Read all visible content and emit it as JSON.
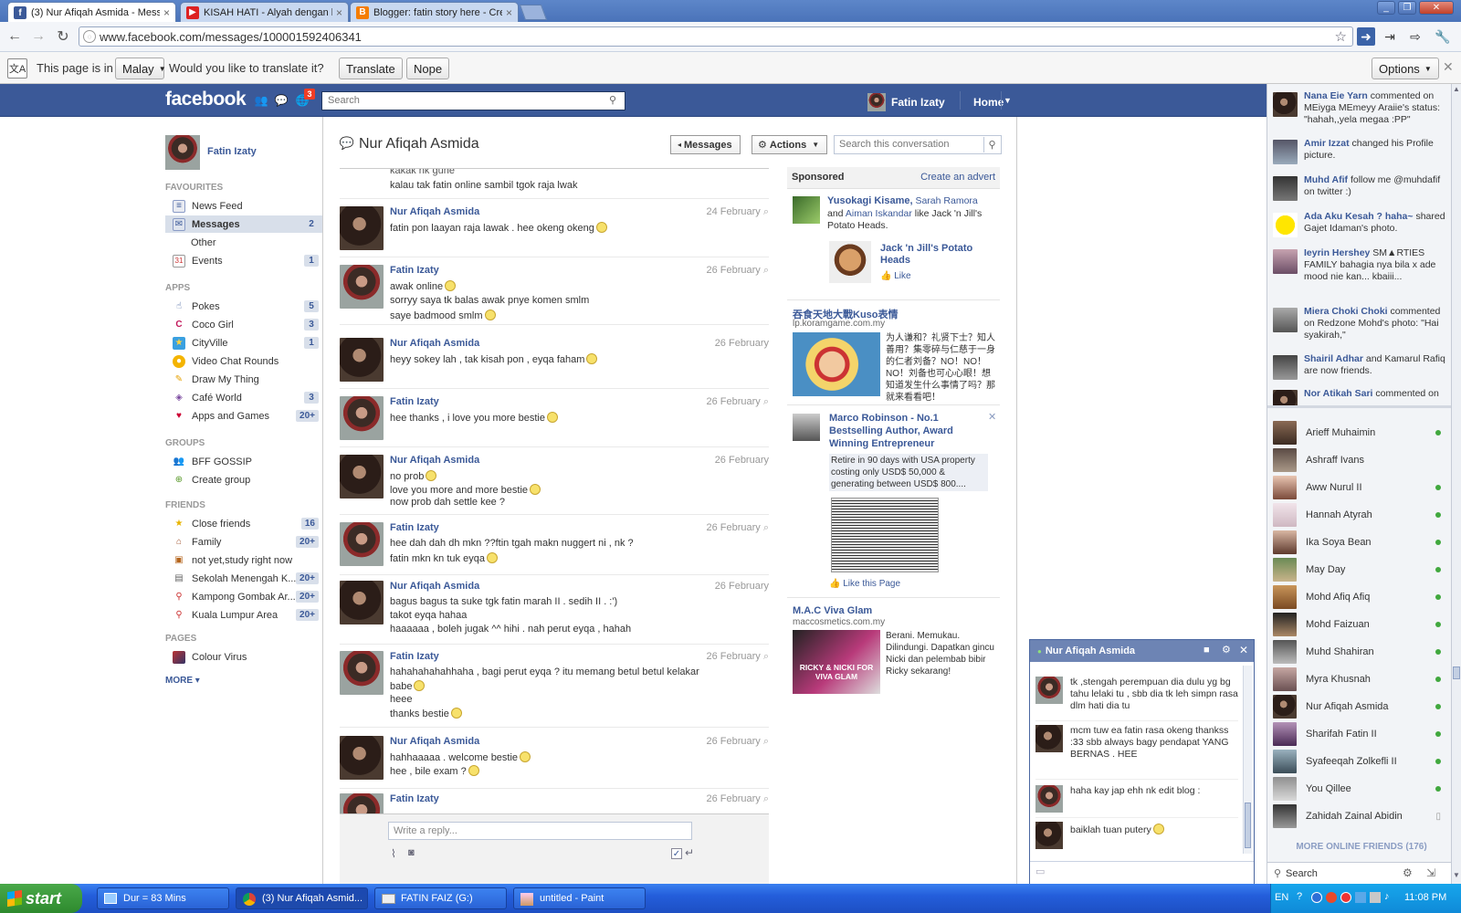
{
  "browser": {
    "tabs": [
      {
        "title": "(3) Nur Afiqah Asmida - Messa"
      },
      {
        "title": "KISAH HATI - Alyah dengan lir"
      },
      {
        "title": "Blogger: fatin story here - Cre"
      }
    ],
    "url": "www.facebook.com/messages/100001592406341"
  },
  "translate_bar": {
    "prefix": "This page is in",
    "language": "Malay",
    "question": "Would you like to translate it?",
    "translate_label": "Translate",
    "nope_label": "Nope",
    "options_label": "Options"
  },
  "fb": {
    "logo": "facebook",
    "notif_count": "3",
    "search_placeholder": "Search",
    "user_name": "Fatin Izaty",
    "home_label": "Home"
  },
  "leftnav": {
    "profile_name": "Fatin Izaty",
    "sections": {
      "favourites": "FAVOURITES",
      "apps": "APPS",
      "groups": "GROUPS",
      "friends": "FRIENDS",
      "pages": "PAGES"
    },
    "favourites": [
      {
        "label": "News Feed",
        "count": ""
      },
      {
        "label": "Messages",
        "count": "2"
      },
      {
        "label": "Other",
        "count": ""
      },
      {
        "label": "Events",
        "count": "1"
      }
    ],
    "apps": [
      {
        "label": "Pokes",
        "count": "5"
      },
      {
        "label": "Coco Girl",
        "count": "3"
      },
      {
        "label": "CityVille",
        "count": "1"
      },
      {
        "label": "Video Chat Rounds",
        "count": ""
      },
      {
        "label": "Draw My Thing",
        "count": ""
      },
      {
        "label": "Café World",
        "count": "3"
      },
      {
        "label": "Apps and Games",
        "count": "20+"
      }
    ],
    "groups": [
      {
        "label": "BFF GOSSIP"
      },
      {
        "label": "Create group"
      }
    ],
    "friends": [
      {
        "label": "Close friends",
        "count": "16"
      },
      {
        "label": "Family",
        "count": "20+"
      },
      {
        "label": "not yet,study right now",
        "count": ""
      },
      {
        "label": "Sekolah Menengah K...",
        "count": "20+"
      },
      {
        "label": "Kampong Gombak Ar...",
        "count": "20+"
      },
      {
        "label": "Kuala Lumpur Area",
        "count": "20+"
      }
    ],
    "pages": [
      {
        "label": "Colour Virus"
      }
    ],
    "more_label": "MORE"
  },
  "conversation": {
    "title": "Nur Afiqah Asmida",
    "messages_btn": "Messages",
    "actions_btn": "Actions",
    "search_placeholder": "Search this conversation",
    "top_partial": [
      "kakak nk gune",
      "kalau tak fatin online sambil tgok raja lwak"
    ],
    "messages": [
      {
        "name": "Nur Afiqah Asmida",
        "date": "24 February",
        "lines": [
          "fatin pon laayan raja lawak . hee okeng okeng"
        ]
      },
      {
        "name": "Fatin Izaty",
        "date": "26 February",
        "lines": [
          "awak online",
          "sorryy saya tk balas awak pnye komen smlm",
          "saye badmood smlm"
        ]
      },
      {
        "name": "Nur Afiqah Asmida",
        "date": "26 February",
        "lines": [
          "heyy  sokey lah , tak kisah pon , eyqa faham"
        ]
      },
      {
        "name": "Fatin Izaty",
        "date": "26 February",
        "lines": [
          "hee  thanks ,  i love you more bestie"
        ]
      },
      {
        "name": "Nur Afiqah Asmida",
        "date": "26 February",
        "lines": [
          "no prob",
          "love you more and more bestie",
          "now prob dah settle kee ?"
        ]
      },
      {
        "name": "Fatin Izaty",
        "date": "26 February",
        "lines": [
          "hee dah dah  dh mkn ??ftin tgah makn nuggert ni , nk ?",
          "fatin mkn kn tuk eyqa"
        ]
      },
      {
        "name": "Nur Afiqah Asmida",
        "date": "26 February",
        "lines": [
          "bagus bagus  ta suke tgk fatin marah II . sedih II . :')",
          "takot eyqa  hahaa",
          "haaaaaa , boleh jugak ^^ hihi . nah perut eyqa , hahah"
        ]
      },
      {
        "name": "Fatin Izaty",
        "date": "26 February",
        "lines": [
          "hahahahahahhaha , bagi perut eyqa ? itu memang betul betul kelakar",
          "babe",
          "heee",
          "thanks bestie"
        ]
      },
      {
        "name": "Nur Afiqah Asmida",
        "date": "26 February",
        "lines": [
          "hahhaaaaa . welcome bestie",
          "hee , bile exam ?"
        ]
      },
      {
        "name": "Fatin Izaty",
        "date": "26 February",
        "lines": []
      }
    ],
    "reply_placeholder": "Write a reply..."
  },
  "sponsored": {
    "heading": "Sponsored",
    "create_advert": "Create an advert",
    "social_ad": {
      "names": "Yusokagi Kisame,",
      "name2": "Sarah Ramora",
      "and_text": "and",
      "name3": "Aiman Iskandar",
      "like_text": "like Jack 'n Jill's Potato Heads.",
      "page": "Jack 'n Jill's Potato Heads",
      "like_label": "Like"
    },
    "ad1": {
      "title": "吞食天地大戰Kuso表情",
      "domain": "lp.koramgame.com.my",
      "body": "为人谦和？礼贤下士？知人善用？集零碎与仁慈于一身的仁者刘备？NO！NO！NO！刘备也可心心眼！想知道发生什么事情了吗？那就来看看吧！"
    },
    "ad2": {
      "title": "Marco Robinson - No.1 Bestselling Author, Award Winning Entrepreneur",
      "body": "Retire in 90 days with USA property costing only USD$ 50,000 & generating between USD$ 800....",
      "like_page": "Like this Page"
    },
    "ad3": {
      "title": "M.A.C Viva Glam",
      "domain": "maccosmetics.com.my",
      "body": "Berani. Memukau. Dilindungi. Dapatkan gincu Nicki dan pelembab bibir Ricky sekarang!",
      "image_text": "RICKY & NICKI FOR VIVA GLAM"
    }
  },
  "ticker": [
    {
      "name": "Nana Eie Yarn",
      "text": "commented on MEiyga MEmeyy Araiie's status: \"hahah,,yela megaa :PP\""
    },
    {
      "name": "Amir Izzat",
      "text": "changed his Profile picture."
    },
    {
      "name": "Muhd Afif",
      "text": "follow me @muhdafif on twitter :)"
    },
    {
      "name": "Ada Aku Kesah ? haha~",
      "text": "shared Gajet Idaman's photo."
    },
    {
      "name": "Ieyrin Hershey",
      "text": "SM▲RTIES FAMILY bahagia nya bila x ade mood nie kan... kbaiii..."
    },
    {
      "name": "Miera Choki Choki",
      "text": "commented on Redzone Mohd's photo: \"Hai syakirah,\""
    },
    {
      "name": "Shairil Adhar",
      "text": "and Kamarul Rafiq are now friends."
    },
    {
      "name": "Nor Atikah Sari",
      "text": "commented on"
    }
  ],
  "online_friends": [
    "Arieff Muhaimin",
    "Ashraff Ivans",
    "Aww Nurul II",
    "Hannah Atyrah",
    "Ika Soya Bean",
    "May Day",
    "Mohd Afiq Afiq",
    "Mohd Faizuan",
    "Muhd Shahiran",
    "Myra Khusnah",
    "Nur Afiqah Asmida",
    "Sharifah Fatin II",
    "Syafeeqah Zolkefli II",
    "You Qillee",
    "Zahidah Zainal Abidin"
  ],
  "more_online": "MORE ONLINE FRIENDS (176)",
  "sidebar_search": "Search",
  "chat": {
    "name": "Nur Afiqah Asmida",
    "messages": [
      {
        "text": "tk ,stengah perempuan dia dulu yg bg tahu lelaki tu , sbb dia tk leh simpn rasa dlm hati dia tu"
      },
      {
        "text": "mcm tuw ea fatin rasa  okeng thankss :33 sbb always bagy pendapat  YANG BERNAS . HEE"
      },
      {
        "text": "haha kay jap ehh nk edit blog :"
      },
      {
        "text": "baiklah tuan putery"
      }
    ]
  },
  "taskbar": {
    "start": "start",
    "items": [
      "Dur = 83 Mins",
      "(3) Nur Afiqah Asmid...",
      "FATIN FAIZ (G:)",
      "untitled - Paint"
    ],
    "lang": "EN",
    "clock": "11:08 PM"
  }
}
